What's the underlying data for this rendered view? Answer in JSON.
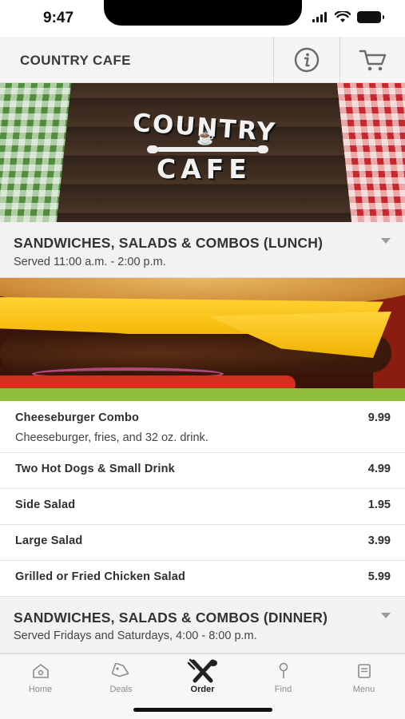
{
  "status_bar": {
    "time": "9:47"
  },
  "header": {
    "title": "COUNTRY CAFE",
    "info_icon": "info-icon",
    "cart_icon": "cart-icon"
  },
  "hero": {
    "logo_line1": "COUNTRY",
    "logo_line2": "CAFE"
  },
  "sections": [
    {
      "title": "SANDWICHES, SALADS & COMBOS (LUNCH)",
      "subtitle": "Served 11:00 a.m. - 2:00 p.m.",
      "items": [
        {
          "name": "Cheeseburger Combo",
          "price": "9.99",
          "description": "Cheeseburger, fries, and 32 oz. drink."
        },
        {
          "name": "Two Hot Dogs & Small Drink",
          "price": "4.99"
        },
        {
          "name": "Side Salad",
          "price": "1.95"
        },
        {
          "name": "Large Salad",
          "price": "3.99"
        },
        {
          "name": "Grilled or Fried Chicken Salad",
          "price": "5.99"
        }
      ]
    },
    {
      "title": "SANDWICHES, SALADS & COMBOS (DINNER)",
      "subtitle": "Served Fridays and Saturdays, 4:00 - 8:00 p.m."
    }
  ],
  "tabs": [
    {
      "label": "Home",
      "icon": "home-icon"
    },
    {
      "label": "Deals",
      "icon": "tag-icon"
    },
    {
      "label": "Order",
      "icon": "utensils-icon",
      "active": true
    },
    {
      "label": "Find",
      "icon": "pin-icon"
    },
    {
      "label": "Menu",
      "icon": "book-icon"
    }
  ],
  "colors": {
    "header_bg": "#f4f4f4",
    "section_bg": "#f2f2f2",
    "active_tab": "#222222",
    "inactive_tab": "#8b8b8b"
  }
}
